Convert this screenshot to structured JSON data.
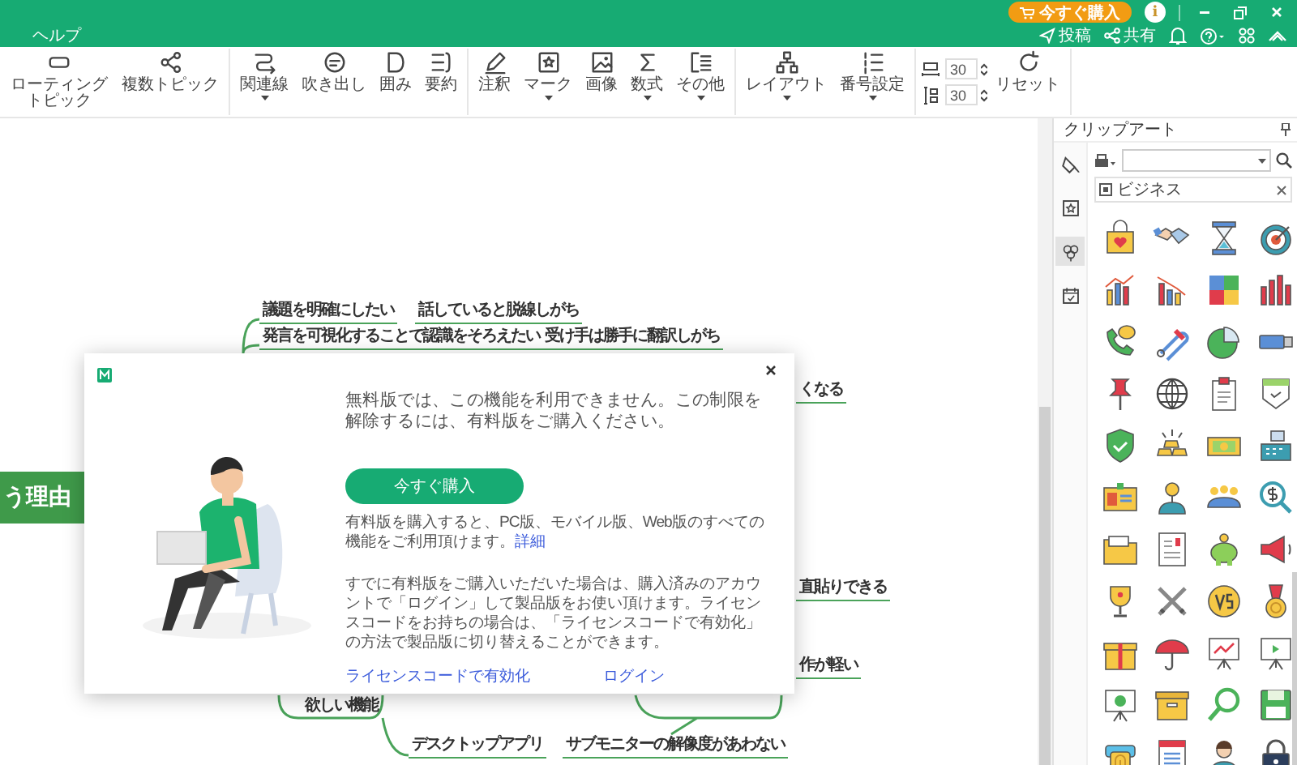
{
  "title_bar": {
    "buy_button": "今すぐ購入",
    "info_button": "i",
    "menu": [
      "ヘルプ"
    ],
    "actions": [
      {
        "kind": "publish",
        "label": "投稿"
      },
      {
        "kind": "share",
        "label": "共有"
      }
    ]
  },
  "toolbar": {
    "groups": [
      [
        {
          "kind": "floating",
          "label": "ローティングトピック",
          "dropdown": false
        },
        {
          "kind": "multi",
          "label": "複数トピック",
          "dropdown": false
        }
      ],
      [
        {
          "kind": "relation",
          "label": "関連線",
          "dropdown": true
        },
        {
          "kind": "callout",
          "label": "吹き出し",
          "dropdown": false
        },
        {
          "kind": "boundary",
          "label": "囲み",
          "dropdown": false
        },
        {
          "kind": "summary",
          "label": "要約",
          "dropdown": false
        }
      ],
      [
        {
          "kind": "note",
          "label": "注釈",
          "dropdown": false
        },
        {
          "kind": "mark",
          "label": "マーク",
          "dropdown": true
        },
        {
          "kind": "image",
          "label": "画像",
          "dropdown": false
        },
        {
          "kind": "formula",
          "label": "数式",
          "dropdown": true
        },
        {
          "kind": "other",
          "label": "その他",
          "dropdown": true
        }
      ],
      [
        {
          "kind": "layout",
          "label": "レイアウト",
          "dropdown": true
        },
        {
          "kind": "numbering",
          "label": "番号設定",
          "dropdown": true
        }
      ]
    ],
    "spacing": {
      "horizontal": "30",
      "vertical": "30"
    },
    "reset": "リセット"
  },
  "mind_map": {
    "central_topic": "う理由",
    "topics": [
      {
        "text": "議題を明確にしたい"
      },
      {
        "text": "話していると脱線しがち"
      },
      {
        "text": "発言を可視化することで認識をそろえたい"
      },
      {
        "text": "受け手は勝手に翻訳しがち"
      },
      {
        "text": "くなる"
      },
      {
        "text": "直貼りできる"
      },
      {
        "text": "作が軽い"
      },
      {
        "text": "欲しい機能"
      },
      {
        "text": "デスクトップアプリ"
      },
      {
        "text": "サブモニターの解像度があわない"
      }
    ]
  },
  "clipart_panel": {
    "title": "クリップアート",
    "tabs": [
      {
        "selected": false
      },
      {
        "selected": false
      },
      {
        "selected": true
      },
      {
        "selected": false
      }
    ],
    "category": "ビジネス"
  },
  "dialog": {
    "message": "無料版では、この機能を利用できません。この制限を解除するには、有料版をご購入ください。",
    "buy_button": "今すぐ購入",
    "note": "有料版を購入すると、PC版、モバイル版、Web版のすべての機能をご利用頂けます。",
    "details_link": "詳細",
    "info": "すでに有料版をご購入いただいた場合は、購入済みのアカウントで「ログイン」して製品版をお使い頂けます。ライセンスコードをお持ちの場合は、「ライセンスコードで有効化」の方法で製品版に切り替えることができます。",
    "license_link": "ライセンスコードで有効化",
    "login_link": "ログイン"
  }
}
